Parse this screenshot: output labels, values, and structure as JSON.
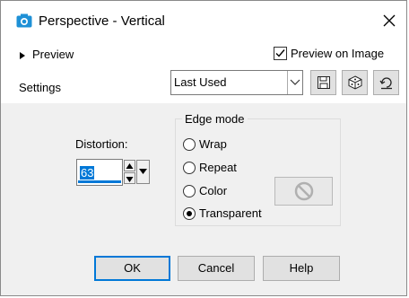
{
  "window": {
    "title": "Perspective - Vertical"
  },
  "top": {
    "preview_label": "Preview",
    "preview_on_image_label": "Preview on Image",
    "preview_on_image_checked": true,
    "settings_label": "Settings",
    "settings_selected": "Last Used"
  },
  "toolbar_icons": [
    "save-icon",
    "dice-icon",
    "reset-icon"
  ],
  "distortion": {
    "label": "Distortion:",
    "value": "63"
  },
  "edge_mode": {
    "title": "Edge mode",
    "options": [
      "Wrap",
      "Repeat",
      "Color",
      "Transparent"
    ],
    "selected": "Transparent"
  },
  "buttons": {
    "ok": "OK",
    "cancel": "Cancel",
    "help": "Help"
  }
}
